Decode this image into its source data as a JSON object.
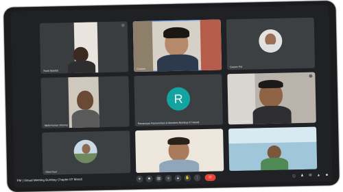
{
  "meeting": {
    "time": "PM",
    "separator": "|",
    "title": "Virtual Meeting Bombay Chapter IIT Mandi"
  },
  "participants": [
    {
      "name": "Swati Mandal"
    },
    {
      "name": "Goutam"
    },
    {
      "name": "Gaurav Pal"
    },
    {
      "name": "Nikhil Kumar Sharma"
    },
    {
      "name": "Ramanujan Ramamohan & Members Bombay IIT Mandi",
      "avatar_letter": "R"
    },
    {
      "name": "Sourav Chatterjee"
    },
    {
      "name": "Oliva Kaul"
    },
    {
      "name": ""
    },
    {
      "name": ""
    }
  ],
  "controls": {
    "end_call_icon": "phone-hangup-icon",
    "colors": {
      "end_call": "#ea4335",
      "avatar": "#12a4a0",
      "active_outline": "#8ab4f8"
    }
  }
}
